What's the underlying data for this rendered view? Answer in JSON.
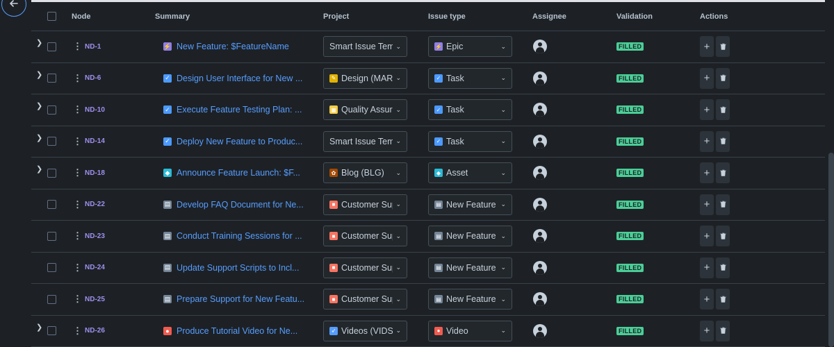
{
  "header": {
    "node": "Node",
    "summary": "Summary",
    "project": "Project",
    "issue_type": "Issue type",
    "assignee": "Assignee",
    "validation": "Validation",
    "actions": "Actions"
  },
  "colors": {
    "epic": "#8f7ee7",
    "task": "#4c9aff",
    "asset": "#2abbd6",
    "video": "#f15b50",
    "new_feature": "#9fadbc",
    "badge": "#4bce97"
  },
  "rows": [
    {
      "key": "ND-1",
      "expandable": true,
      "summary": "New Feature: $FeatureName",
      "summary_icon": "epic-icon",
      "project": "Smart Issue Templates",
      "project_icon": "",
      "type": "Epic",
      "type_icon": "epic-icon",
      "validation": "FILLED"
    },
    {
      "key": "ND-6",
      "expandable": true,
      "summary": "Design User Interface for New ...",
      "summary_icon": "task-icon",
      "project": "Design (MARK)",
      "project_icon": "design-icon",
      "type": "Task",
      "type_icon": "task-icon",
      "validation": "FILLED"
    },
    {
      "key": "ND-10",
      "expandable": true,
      "summary": "Execute Feature Testing Plan: ...",
      "summary_icon": "task-icon",
      "project": "Quality Assurance",
      "project_icon": "qa-icon",
      "type": "Task",
      "type_icon": "task-icon",
      "validation": "FILLED"
    },
    {
      "key": "ND-14",
      "expandable": true,
      "summary": "Deploy New Feature to Produc...",
      "summary_icon": "task-icon",
      "project": "Smart Issue Templates",
      "project_icon": "",
      "type": "Task",
      "type_icon": "task-icon",
      "validation": "FILLED"
    },
    {
      "key": "ND-18",
      "expandable": true,
      "summary": "Announce Feature Launch: $F...",
      "summary_icon": "asset-icon",
      "project": "Blog (BLG)",
      "project_icon": "blog-icon",
      "type": "Asset",
      "type_icon": "asset-icon",
      "validation": "FILLED"
    },
    {
      "key": "ND-22",
      "expandable": false,
      "summary": "Develop FAQ Document for Ne...",
      "summary_icon": "new-feature-icon",
      "project": "Customer Support",
      "project_icon": "support-icon",
      "type": "New Feature",
      "type_icon": "new-feature-icon",
      "validation": "FILLED"
    },
    {
      "key": "ND-23",
      "expandable": false,
      "summary": "Conduct Training Sessions for ...",
      "summary_icon": "new-feature-icon",
      "project": "Customer Support",
      "project_icon": "support-icon",
      "type": "New Feature",
      "type_icon": "new-feature-icon",
      "validation": "FILLED"
    },
    {
      "key": "ND-24",
      "expandable": false,
      "summary": "Update Support Scripts to Incl...",
      "summary_icon": "new-feature-icon",
      "project": "Customer Support",
      "project_icon": "support-icon",
      "type": "New Feature",
      "type_icon": "new-feature-icon",
      "validation": "FILLED"
    },
    {
      "key": "ND-25",
      "expandable": false,
      "summary": "Prepare Support for New Featu...",
      "summary_icon": "new-feature-icon",
      "project": "Customer Support",
      "project_icon": "support-icon",
      "type": "New Feature",
      "type_icon": "new-feature-icon",
      "validation": "FILLED"
    },
    {
      "key": "ND-26",
      "expandable": true,
      "summary": "Produce Tutorial Video for Ne...",
      "summary_icon": "video-icon",
      "project": "Videos (VIDS)",
      "project_icon": "videos-icon",
      "type": "Video",
      "type_icon": "video-icon",
      "validation": "FILLED"
    }
  ]
}
